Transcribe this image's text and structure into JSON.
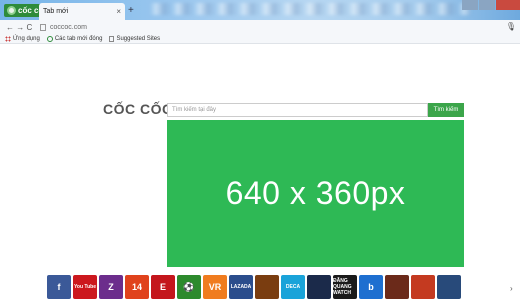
{
  "browser": {
    "brand_label": "cốc cốc",
    "tab_title": "Tab mới",
    "tab_close": "×",
    "newtab": "+",
    "nav": "← → C",
    "address": "coccoc.com",
    "mic": "🎙"
  },
  "bookmarks": [
    {
      "label": "Ứng dụng",
      "icon": "apps-icon"
    },
    {
      "label": "Các tab mới đóng",
      "icon": "recent-tabs-icon"
    },
    {
      "label": "Suggested Sites",
      "icon": "page-icon"
    }
  ],
  "newtab_page": {
    "logo": "CỐC CỐC",
    "search_placeholder": "Tìm kiếm tại đây",
    "search_button": "Tìm kiếm",
    "banner_text": "640 x 360px"
  },
  "shortcuts": [
    {
      "name": "facebook",
      "label": "f",
      "color": "#3b5998"
    },
    {
      "name": "youtube",
      "label": "You Tube",
      "color": "#cc181e"
    },
    {
      "name": "zing",
      "label": "Z",
      "color": "#6c2d8c"
    },
    {
      "name": "game-14",
      "label": "14",
      "color": "#e0421c"
    },
    {
      "name": "e-app",
      "label": "E",
      "color": "#c4161c"
    },
    {
      "name": "soccer",
      "label": "⚽",
      "color": "#2d8a2d"
    },
    {
      "name": "vr",
      "label": "VR",
      "color": "#f07c1f"
    },
    {
      "name": "lazada",
      "label": "LAZADA",
      "color": "#2b4d8c"
    },
    {
      "name": "game-2",
      "label": "",
      "color": "#7a3d10"
    },
    {
      "name": "deca",
      "label": "DECA",
      "color": "#1aa3d9"
    },
    {
      "name": "game-3",
      "label": "",
      "color": "#1b2a4a"
    },
    {
      "name": "dang-quang-watch",
      "label": "ĐĂNG QUANG WATCH",
      "color": "#1a1a1a"
    },
    {
      "name": "bing",
      "label": "b",
      "color": "#1e6fd0"
    },
    {
      "name": "game-4",
      "label": "",
      "color": "#6b2a1a"
    },
    {
      "name": "game-5",
      "label": "",
      "color": "#c43a20"
    },
    {
      "name": "game-6",
      "label": "",
      "color": "#284a7a"
    }
  ],
  "more_glyph": "›"
}
